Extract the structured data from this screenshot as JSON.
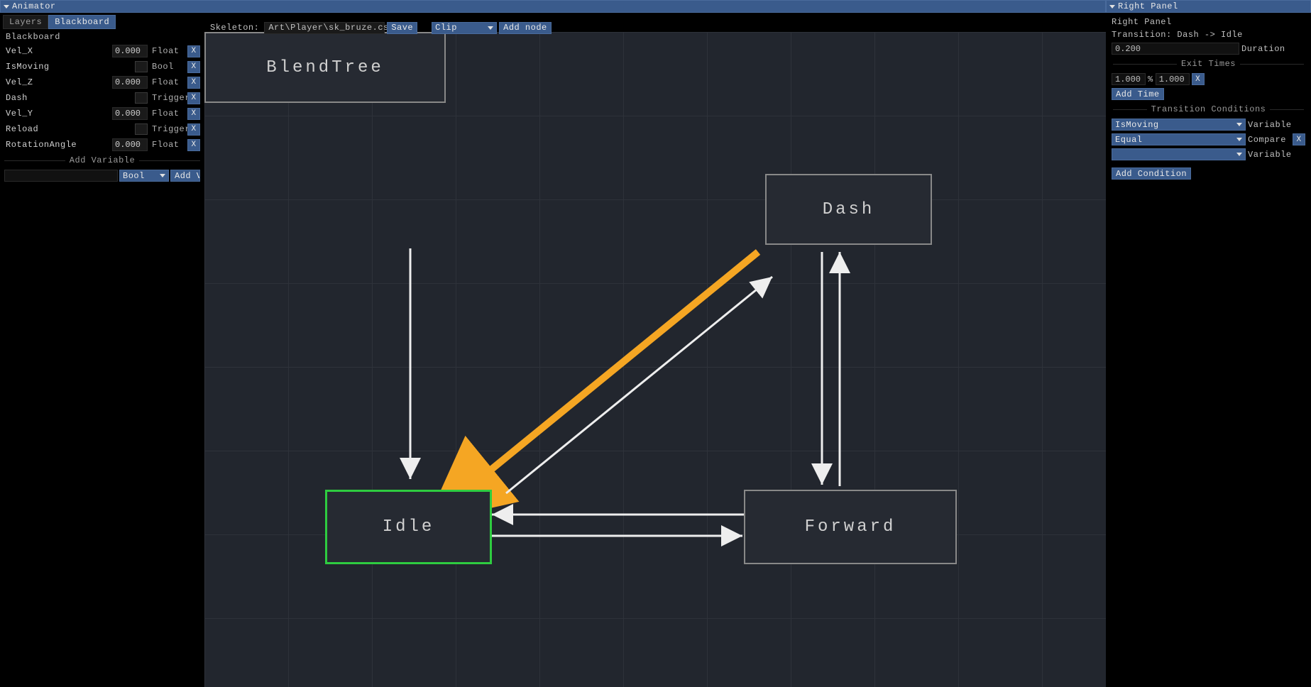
{
  "windows": {
    "animator_title": "Animator",
    "right_panel_title": "Right Panel"
  },
  "left": {
    "tabs": {
      "layers": "Layers",
      "blackboard": "Blackboard"
    },
    "section": "Blackboard",
    "vars": [
      {
        "name": "Vel_X",
        "value": "0.000",
        "type": "Float",
        "has_value": true
      },
      {
        "name": "IsMoving",
        "value": "",
        "type": "Bool",
        "has_value": false
      },
      {
        "name": "Vel_Z",
        "value": "0.000",
        "type": "Float",
        "has_value": true
      },
      {
        "name": "Dash",
        "value": "",
        "type": "Trigger",
        "has_value": false
      },
      {
        "name": "Vel_Y",
        "value": "0.000",
        "type": "Float",
        "has_value": true
      },
      {
        "name": "Reload",
        "value": "",
        "type": "Trigger",
        "has_value": false
      },
      {
        "name": "RotationAngle",
        "value": "0.000",
        "type": "Float",
        "has_value": true
      }
    ],
    "add_var_header": "Add Variable",
    "add_var_type": "Bool",
    "add_var_btn": "Add V…"
  },
  "toolbar": {
    "skeleton_label": "Skeleton:",
    "skeleton_path": "Art\\Player\\sk_bruze.csk",
    "save": "Save",
    "clip": "Clip",
    "add_node": "Add node"
  },
  "nodes": {
    "blendtree": "BlendTree",
    "idle": "Idle",
    "dash": "Dash",
    "forward": "Forward"
  },
  "right": {
    "header": "Right Panel",
    "transition": "Transition: Dash -> Idle",
    "duration_value": "0.200",
    "duration_label": "Duration",
    "exit_times_header": "Exit Times",
    "exit_a": "1.000",
    "exit_pct": "%",
    "exit_b": "1.000",
    "add_time": "Add Time",
    "conditions_header": "Transition Conditions",
    "cond_var": "IsMoving",
    "cond_var_label": "Variable",
    "cond_cmp": "Equal",
    "cond_cmp_label": "Compare",
    "cond_val": "",
    "cond_val_label": "Variable",
    "add_condition": "Add Condition"
  },
  "x_label": "X"
}
